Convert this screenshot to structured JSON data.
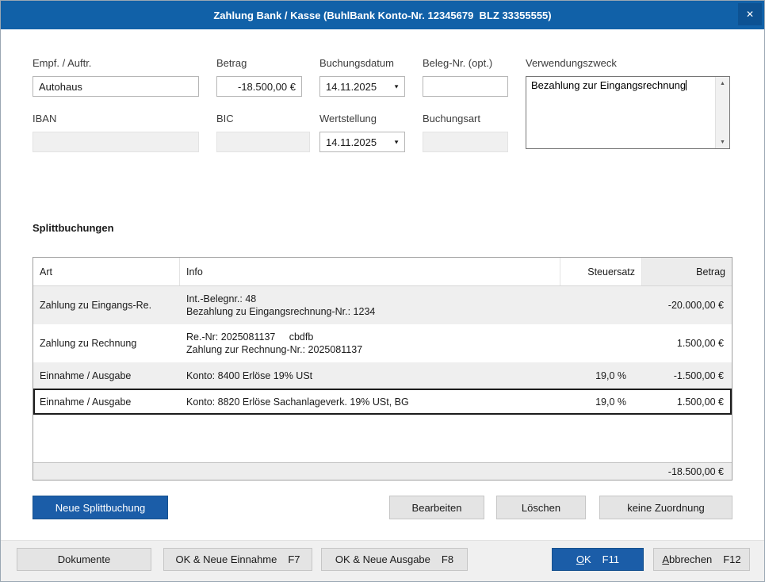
{
  "titlebar": {
    "title": "Zahlung Bank / Kasse (BuhlBank Konto-Nr. 12345679  BLZ 33355555)",
    "close_icon": "✕"
  },
  "icons": {
    "dropdown": "▼",
    "scroll_up": "▲",
    "scroll_down": "▼"
  },
  "form": {
    "empfaenger": {
      "label": "Empf. / Auftr.",
      "value": "Autohaus"
    },
    "betrag": {
      "label": "Betrag",
      "value": "-18.500,00 €"
    },
    "buchungsdatum": {
      "label": "Buchungsdatum",
      "value": "14.11.2025"
    },
    "beleg_nr": {
      "label": "Beleg-Nr. (opt.)",
      "value": ""
    },
    "verwendungszweck": {
      "label": "Verwendungszweck",
      "value": "Bezahlung zur Eingangsrechnung"
    },
    "iban": {
      "label": "IBAN",
      "value": ""
    },
    "bic": {
      "label": "BIC",
      "value": ""
    },
    "wertstellung": {
      "label": "Wertstellung",
      "value": "14.11.2025"
    },
    "buchungsart": {
      "label": "Buchungsart",
      "value": ""
    }
  },
  "splitt": {
    "heading": "Splittbuchungen",
    "columns": [
      "Art",
      "Info",
      "Steuersatz",
      "Betrag"
    ],
    "rows": [
      {
        "art": "Zahlung zu Eingangs-Re.",
        "info_line1": "Int.-Belegnr.: 48",
        "info_line2": "Bezahlung zu Eingangsrechnung-Nr.: 1234",
        "steuersatz": "",
        "betrag": "-20.000,00 €"
      },
      {
        "art": "Zahlung zu Rechnung",
        "info_line1": "Re.-Nr: 2025081137     cbdfb",
        "info_line2": "Zahlung zur Rechnung-Nr.: 2025081137",
        "steuersatz": "",
        "betrag": "1.500,00 €"
      },
      {
        "art": "Einnahme / Ausgabe",
        "info_line1": "Konto: 8400 Erlöse 19% USt",
        "info_line2": "",
        "steuersatz": "19,0 %",
        "betrag": "-1.500,00 €"
      },
      {
        "art": "Einnahme / Ausgabe",
        "info_line1": "Konto: 8820 Erlöse Sachanlageverk. 19% USt, BG",
        "info_line2": "",
        "steuersatz": "19,0 %",
        "betrag": "1.500,00 €"
      }
    ],
    "total": "-18.500,00 €",
    "buttons": {
      "neue": "Neue Splittbuchung",
      "bearbeiten": "Bearbeiten",
      "loeschen": "Löschen",
      "keine_zuordnung": "keine Zuordnung"
    }
  },
  "footer": {
    "dokumente": "Dokumente",
    "ok_neue_einnahme": {
      "label": "OK & Neue Einnahme",
      "fkey": "F7"
    },
    "ok_neue_ausgabe": {
      "label": "OK & Neue Ausgabe",
      "fkey": "F8"
    },
    "ok": {
      "accel": "O",
      "rest": "K",
      "fkey": "F11"
    },
    "abbrechen": {
      "accel": "A",
      "rest": "bbrechen",
      "fkey": "F12"
    }
  }
}
